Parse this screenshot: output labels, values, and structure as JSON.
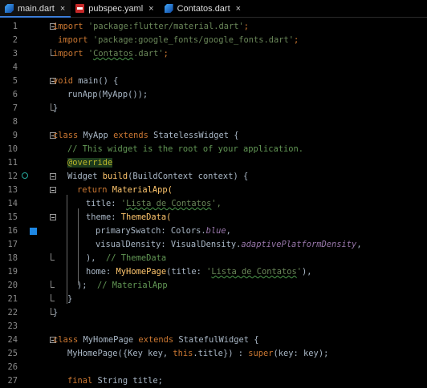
{
  "tabs": [
    {
      "label": "main.dart",
      "icon": "dart-icon",
      "active": true
    },
    {
      "label": "pubspec.yaml",
      "icon": "yaml-icon",
      "active": false
    },
    {
      "label": "Contatos.dart",
      "icon": "dart-icon",
      "active": false
    }
  ],
  "tab_close_glyph": "×",
  "lines": [
    {
      "n": "1"
    },
    {
      "n": "2"
    },
    {
      "n": "3"
    },
    {
      "n": "4"
    },
    {
      "n": "5"
    },
    {
      "n": "6"
    },
    {
      "n": "7"
    },
    {
      "n": "8"
    },
    {
      "n": "9"
    },
    {
      "n": "10"
    },
    {
      "n": "11"
    },
    {
      "n": "12"
    },
    {
      "n": "13"
    },
    {
      "n": "14"
    },
    {
      "n": "15"
    },
    {
      "n": "16"
    },
    {
      "n": "17"
    },
    {
      "n": "18"
    },
    {
      "n": "19"
    },
    {
      "n": "20"
    },
    {
      "n": "21"
    },
    {
      "n": "22"
    },
    {
      "n": "23"
    },
    {
      "n": "24"
    },
    {
      "n": "25"
    },
    {
      "n": "26"
    },
    {
      "n": "27"
    }
  ],
  "code": {
    "kw_import": "import",
    "imp1": "'package:flutter/material.dart'",
    "imp2": "'package:google_fonts/google_fonts.dart'",
    "imp3_q1": "'",
    "imp3_name": "Contatos",
    "imp3_rest": ".dart'",
    "semi": ";",
    "kw_void": "void",
    "main_fn": " main() {",
    "runapp": "runApp(MyApp());",
    "close_brace": "}",
    "kw_class": "class",
    "myapp_name": " MyApp ",
    "kw_extends": "extends",
    "stateless": " StatelessWidget {",
    "comment11": "// This widget is the root of your application.",
    "override": "@override",
    "widget_build_1": "Widget ",
    "build_fn": "build",
    "widget_build_2": "(BuildContext context) {",
    "kw_return": "return",
    "material_app": " MaterialApp(",
    "title_key": "title: ",
    "title_q1": "'",
    "title_val": "Lista de Contatos",
    "title_q2": "',",
    "theme_key": "theme: ",
    "themedata": "ThemeData(",
    "primary_swatch": "primarySwatch: Colors.",
    "blue": "blue",
    "comma": ",",
    "visual_density": "visualDensity: VisualDensity.",
    "adaptive": "adaptivePlatformDensity",
    "close_theme": "),",
    "comment_themedata": "// ThemeData",
    "home_key": "home: ",
    "home_page": "MyHomePage",
    "home_title": "(title: ",
    "home_close": "),",
    "close_paren_semi": ");",
    "comment_materialapp": "// MaterialApp",
    "myhome_name": " MyHomePage ",
    "stateful": " StatefulWidget {",
    "ctor_1": "MyHomePage({Key key, ",
    "kw_this": "this",
    "ctor_2": ".title}) : ",
    "kw_super": "super",
    "ctor_3": "(key: key);",
    "kw_final": "final",
    "final_rest": " String title;"
  },
  "colors": {
    "keyword": "#cc7832",
    "string": "#6a8759",
    "comment": "#629755",
    "function": "#ffc66d",
    "italic_const": "#9876aa",
    "annotation": "#bbb529",
    "breakpoint_square": "#1e88e5",
    "background": "#000000"
  },
  "gutter_icons": {
    "line12": "override-icon",
    "line16": "color-swatch-icon"
  }
}
